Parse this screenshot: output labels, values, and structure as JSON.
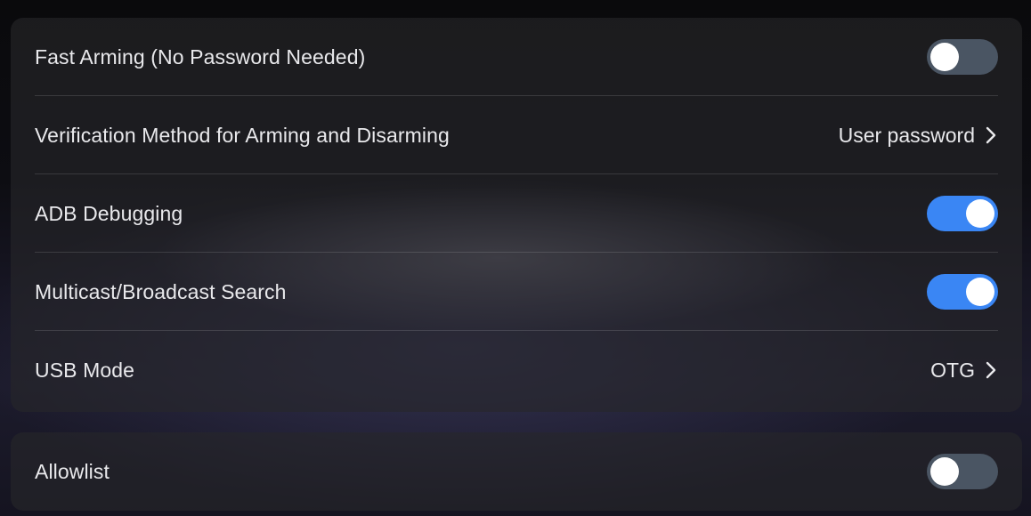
{
  "settings": {
    "main": [
      {
        "label": "Fast Arming (No Password Needed)",
        "control": "toggle",
        "checked": false
      },
      {
        "label": "Verification Method for Arming and Disarming",
        "control": "link",
        "value": "User password",
        "icon": "chevron-right-icon"
      },
      {
        "label": "ADB Debugging",
        "control": "toggle",
        "checked": true
      },
      {
        "label": "Multicast/Broadcast Search",
        "control": "toggle",
        "checked": true
      },
      {
        "label": "USB Mode",
        "control": "link",
        "value": "OTG",
        "icon": "chevron-right-icon"
      }
    ],
    "secondary": [
      {
        "label": "Allowlist",
        "control": "toggle",
        "checked": false
      }
    ]
  },
  "colors": {
    "toggle_on": "#3a86f4",
    "toggle_off": "#4a5563",
    "text": "#e9e9ec"
  }
}
